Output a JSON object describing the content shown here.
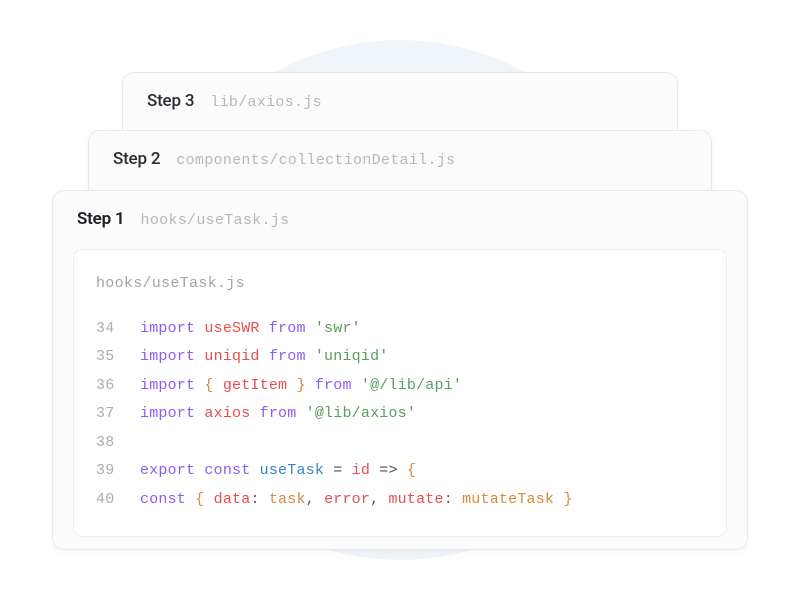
{
  "bg": {
    "color": "#f0f5fb"
  },
  "cards": {
    "step3": {
      "label": "Step 3",
      "file": "lib/axios.js"
    },
    "step2": {
      "label": "Step 2",
      "file": "components/collectionDetail.js"
    },
    "step1": {
      "label": "Step 1",
      "file": "hooks/useTask.js"
    }
  },
  "code": {
    "file_label": "hooks/useTask.js",
    "lines": {
      "l34": {
        "no": "34",
        "kw1": "import",
        "ident": "useSWR",
        "from": "from",
        "str": "'swr'"
      },
      "l35": {
        "no": "35",
        "kw1": "import",
        "ident": "uniqid",
        "from": "from",
        "str": "'uniqid'"
      },
      "l36": {
        "no": "36",
        "kw1": "import",
        "lb": "{ ",
        "ident": "getItem",
        "rb": " }",
        "from": "from",
        "str": "'@/lib/api'"
      },
      "l37": {
        "no": "37",
        "kw1": "import",
        "ident": "axios",
        "from": "from",
        "str": "'@lib/axios'"
      },
      "l38": {
        "no": "38"
      },
      "l39": {
        "no": "39",
        "kw1": "export",
        "kw2": "const",
        "fn": "useTask",
        "eq": "=",
        "param": "id",
        "arrow": "=>",
        "brace": "{"
      },
      "l40": {
        "no": "40",
        "kw1": "const",
        "lb": "{ ",
        "k1": "data",
        "c1": ": ",
        "v1": "task",
        "comma1": ", ",
        "k2": "error",
        "comma2": ", ",
        "k3": "mutate",
        "c3": ": ",
        "v3": "mutateTask",
        "rb": " }"
      }
    }
  }
}
